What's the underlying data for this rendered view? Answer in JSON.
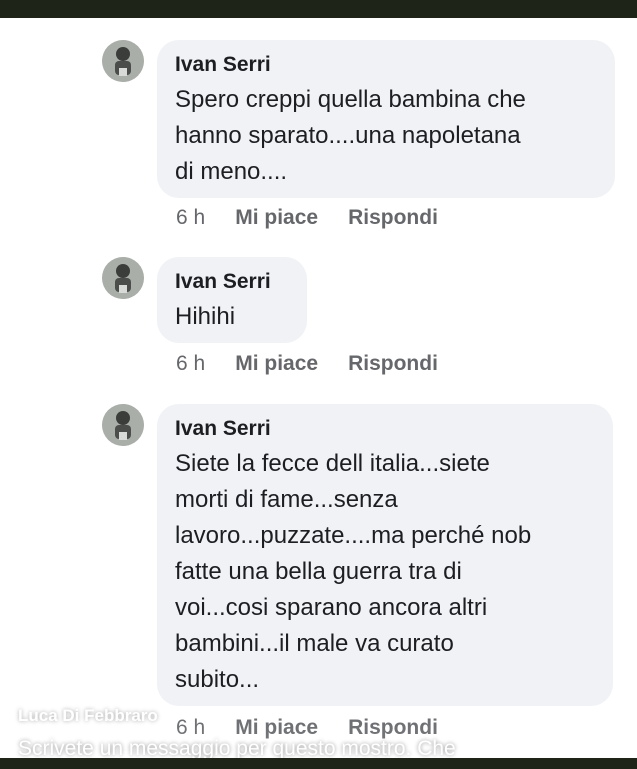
{
  "comments": [
    {
      "author": "Ivan Serri",
      "lines": [
        "Spero creppi quella bambina che",
        "hanno sparato....una napoletana",
        "di meno...."
      ],
      "time": "6 h",
      "like_label": "Mi piace",
      "reply_label": "Rispondi"
    },
    {
      "author": "Ivan Serri",
      "lines": [
        "Hihihi"
      ],
      "time": "6 h",
      "like_label": "Mi piace",
      "reply_label": "Rispondi"
    },
    {
      "author": "Ivan Serri",
      "lines": [
        "Siete la fecce dell italia...siete",
        "morti di fame...senza",
        "lavoro...puzzate....ma perché nob",
        "fatte una bella guerra tra di",
        "voi...cosi sparano ancora altri",
        "bambini...il male va curato",
        "subito..."
      ],
      "time": "6 h",
      "like_label": "Mi piace",
      "reply_label": "Rispondi"
    }
  ],
  "overlay": {
    "name": "Luca Di Febbraro",
    "message": "Scrivete un messaggio per questo mostro. Che"
  },
  "colors": {
    "bubble_bg": "#f0f2f5",
    "text": "#1c1e21",
    "meta": "#65676b",
    "bar": "#1f2418"
  }
}
